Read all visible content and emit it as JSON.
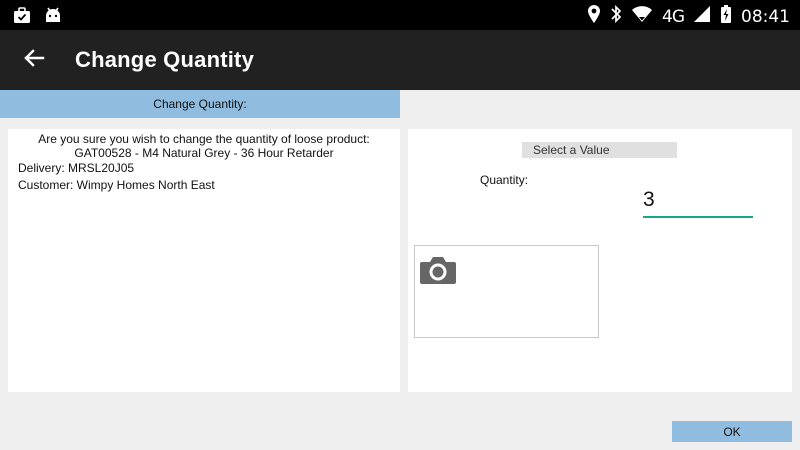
{
  "status_bar": {
    "time": "08:41",
    "network": "4G",
    "icons": [
      "briefcase-check-icon",
      "android-debug-icon",
      "location-icon",
      "bluetooth-icon",
      "wifi-icon",
      "signal-icon",
      "battery-charging-icon"
    ]
  },
  "app_bar": {
    "back_icon": "arrow-left-icon",
    "title": "Change Quantity"
  },
  "section_header": {
    "label": "Change Quantity:"
  },
  "details": {
    "prompt_line1": "Are you sure you wish to change the quantity of loose product:",
    "prompt_line2": "GAT00528 - M4 Natural Grey - 36 Hour Retarder",
    "delivery": "Delivery: MRSL20J05",
    "customer": "Customer: Wimpy Homes North East"
  },
  "quantity_panel": {
    "select_value_label": "Select a Value",
    "quantity_label": "Quantity:",
    "quantity_value": "3",
    "photo_icon": "camera-icon"
  },
  "actions": {
    "ok_label": "OK"
  },
  "colors": {
    "accent_header": "#90bcdf",
    "input_underline": "#17a589",
    "app_bar": "#212121"
  }
}
